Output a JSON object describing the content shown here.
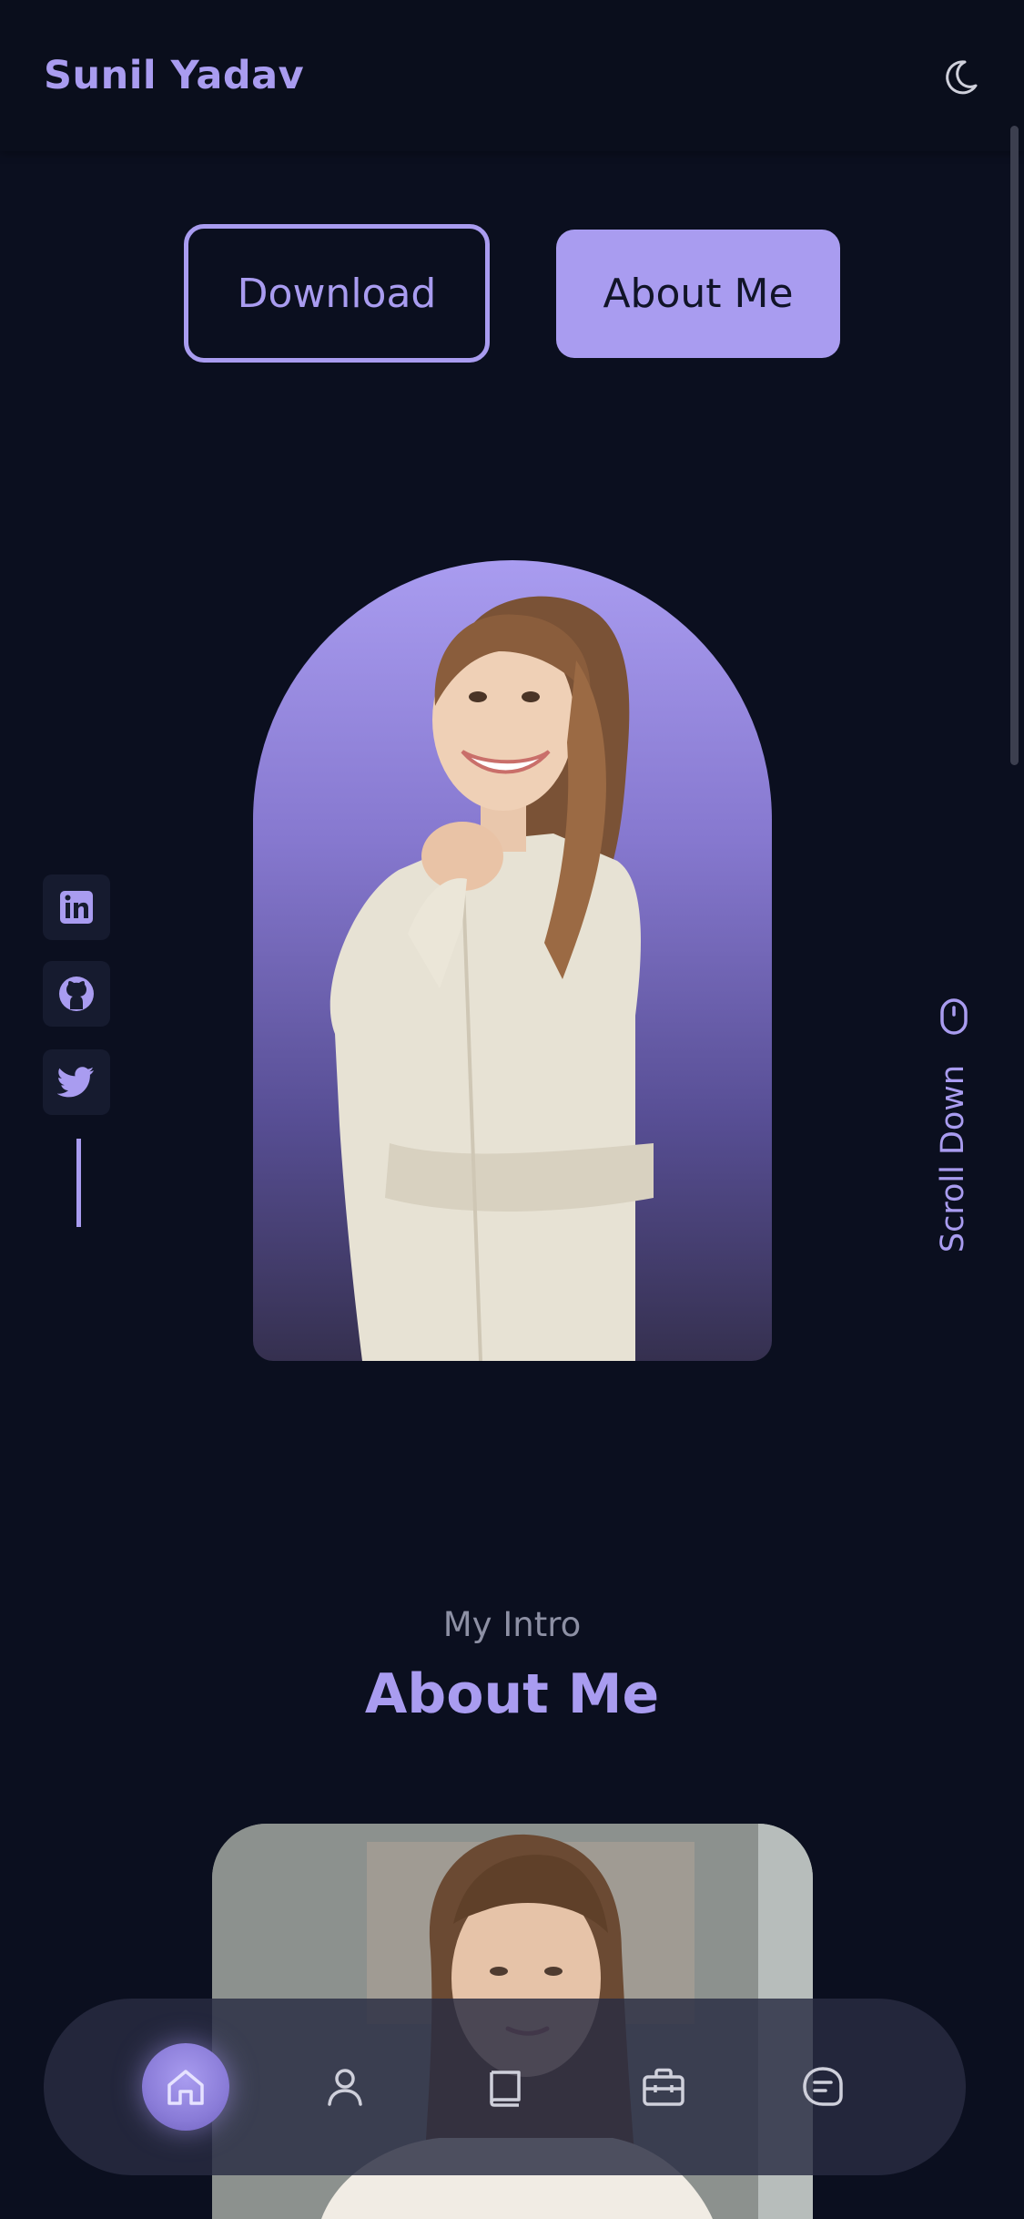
{
  "header": {
    "logo_text": "Sunil Yadav",
    "theme_toggle_icon": "moon-icon"
  },
  "hero": {
    "download_label": "Download",
    "about_label": "About Me",
    "scroll_down_label": "Scroll Down",
    "scroll_down_icon": "mouse-icon"
  },
  "social": {
    "items": [
      {
        "name": "linkedin",
        "icon": "linkedin-icon"
      },
      {
        "name": "github",
        "icon": "github-icon"
      },
      {
        "name": "twitter",
        "icon": "twitter-icon"
      }
    ]
  },
  "intro": {
    "subtitle": "My Intro",
    "title": "About Me"
  },
  "bottom_nav": {
    "items": [
      {
        "name": "home",
        "icon": "home-icon",
        "active": true
      },
      {
        "name": "about",
        "icon": "user-icon",
        "active": false
      },
      {
        "name": "qualifications",
        "icon": "book-icon",
        "active": false
      },
      {
        "name": "services",
        "icon": "briefcase-icon",
        "active": false
      },
      {
        "name": "contact",
        "icon": "message-icon",
        "active": false
      }
    ]
  },
  "colors": {
    "accent": "#a99cf0",
    "background": "#0b0f1f",
    "header": "#0a0e1c",
    "muted_text": "#8d90a4"
  }
}
